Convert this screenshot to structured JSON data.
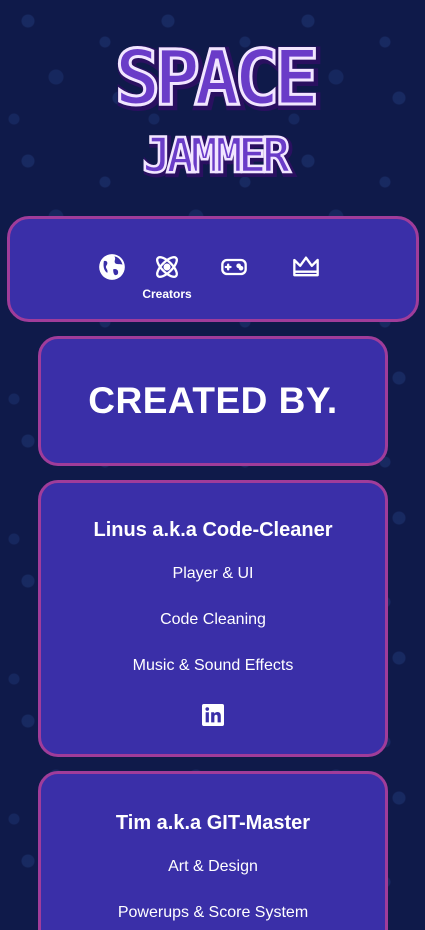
{
  "logo": {
    "line1": "SPACE",
    "line2": "JAMMER",
    "colors": {
      "fill": "#6a3cc8",
      "outline": "#f2e6ff",
      "shadow": "#2a1060"
    }
  },
  "nav": {
    "items": [
      {
        "icon": "globe-icon",
        "label": ""
      },
      {
        "icon": "atom-icon",
        "label": "Creators"
      },
      {
        "icon": "gamepad-icon",
        "label": ""
      },
      {
        "icon": "crown-icon",
        "label": ""
      }
    ]
  },
  "heading": "CREATED BY.",
  "creators": [
    {
      "name": "Linus a.k.a Code-Cleaner",
      "roles": [
        "Player & UI",
        "Code Cleaning",
        "Music & Sound Effects"
      ],
      "social_icon": "linkedin-icon"
    },
    {
      "name": "Tim a.k.a GIT-Master",
      "roles": [
        "Art & Design",
        "Powerups & Score System"
      ]
    }
  ],
  "colors": {
    "background": "#0f1a4a",
    "card": "#3a2fa8",
    "border": "#a03c9a"
  }
}
